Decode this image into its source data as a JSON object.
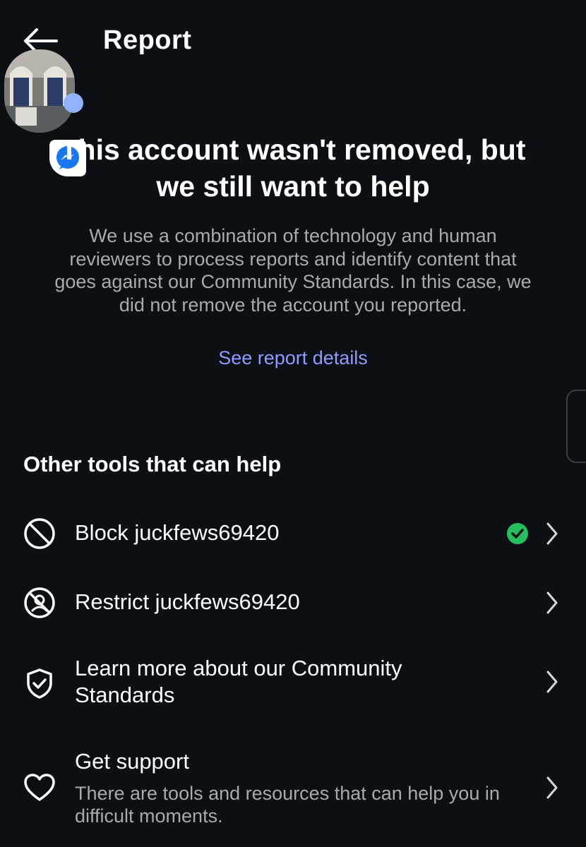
{
  "header": {
    "title": "Report",
    "back_icon": "arrow-left-icon"
  },
  "profile": {
    "avatar": "profile-photo",
    "badge_icon": "messenger-icon",
    "notification_dot_color": "#8fb3ff"
  },
  "main": {
    "headline_line1": "This account wasn't removed, but",
    "headline_line2": "we still want to help",
    "description_line1": "We use a combination of technology and human",
    "description_line2": "reviewers to process reports and identify content that",
    "description_line3": "goes against our Community Standards. In this case, we",
    "description_line4": "did not remove the account you reported.",
    "details_link": "See report details"
  },
  "tools": {
    "section_title": "Other tools that can help",
    "items": [
      {
        "label": "Block juckfews69420",
        "icon": "block-icon",
        "status_icon": "check-circle-icon",
        "status_color": "#25c05e"
      },
      {
        "label": "Restrict juckfews69420",
        "icon": "restrict-icon"
      },
      {
        "label_line1": "Learn more about our Community",
        "label_line2": "Standards",
        "icon": "shield-check-icon"
      },
      {
        "label": "Get support",
        "sub_line1": "There are tools and resources that can help you in",
        "sub_line2": "difficult moments.",
        "icon": "heart-icon"
      }
    ]
  },
  "colors": {
    "background": "#0c1014",
    "link": "#8c9cff",
    "secondary_text": "#a7abb0"
  }
}
